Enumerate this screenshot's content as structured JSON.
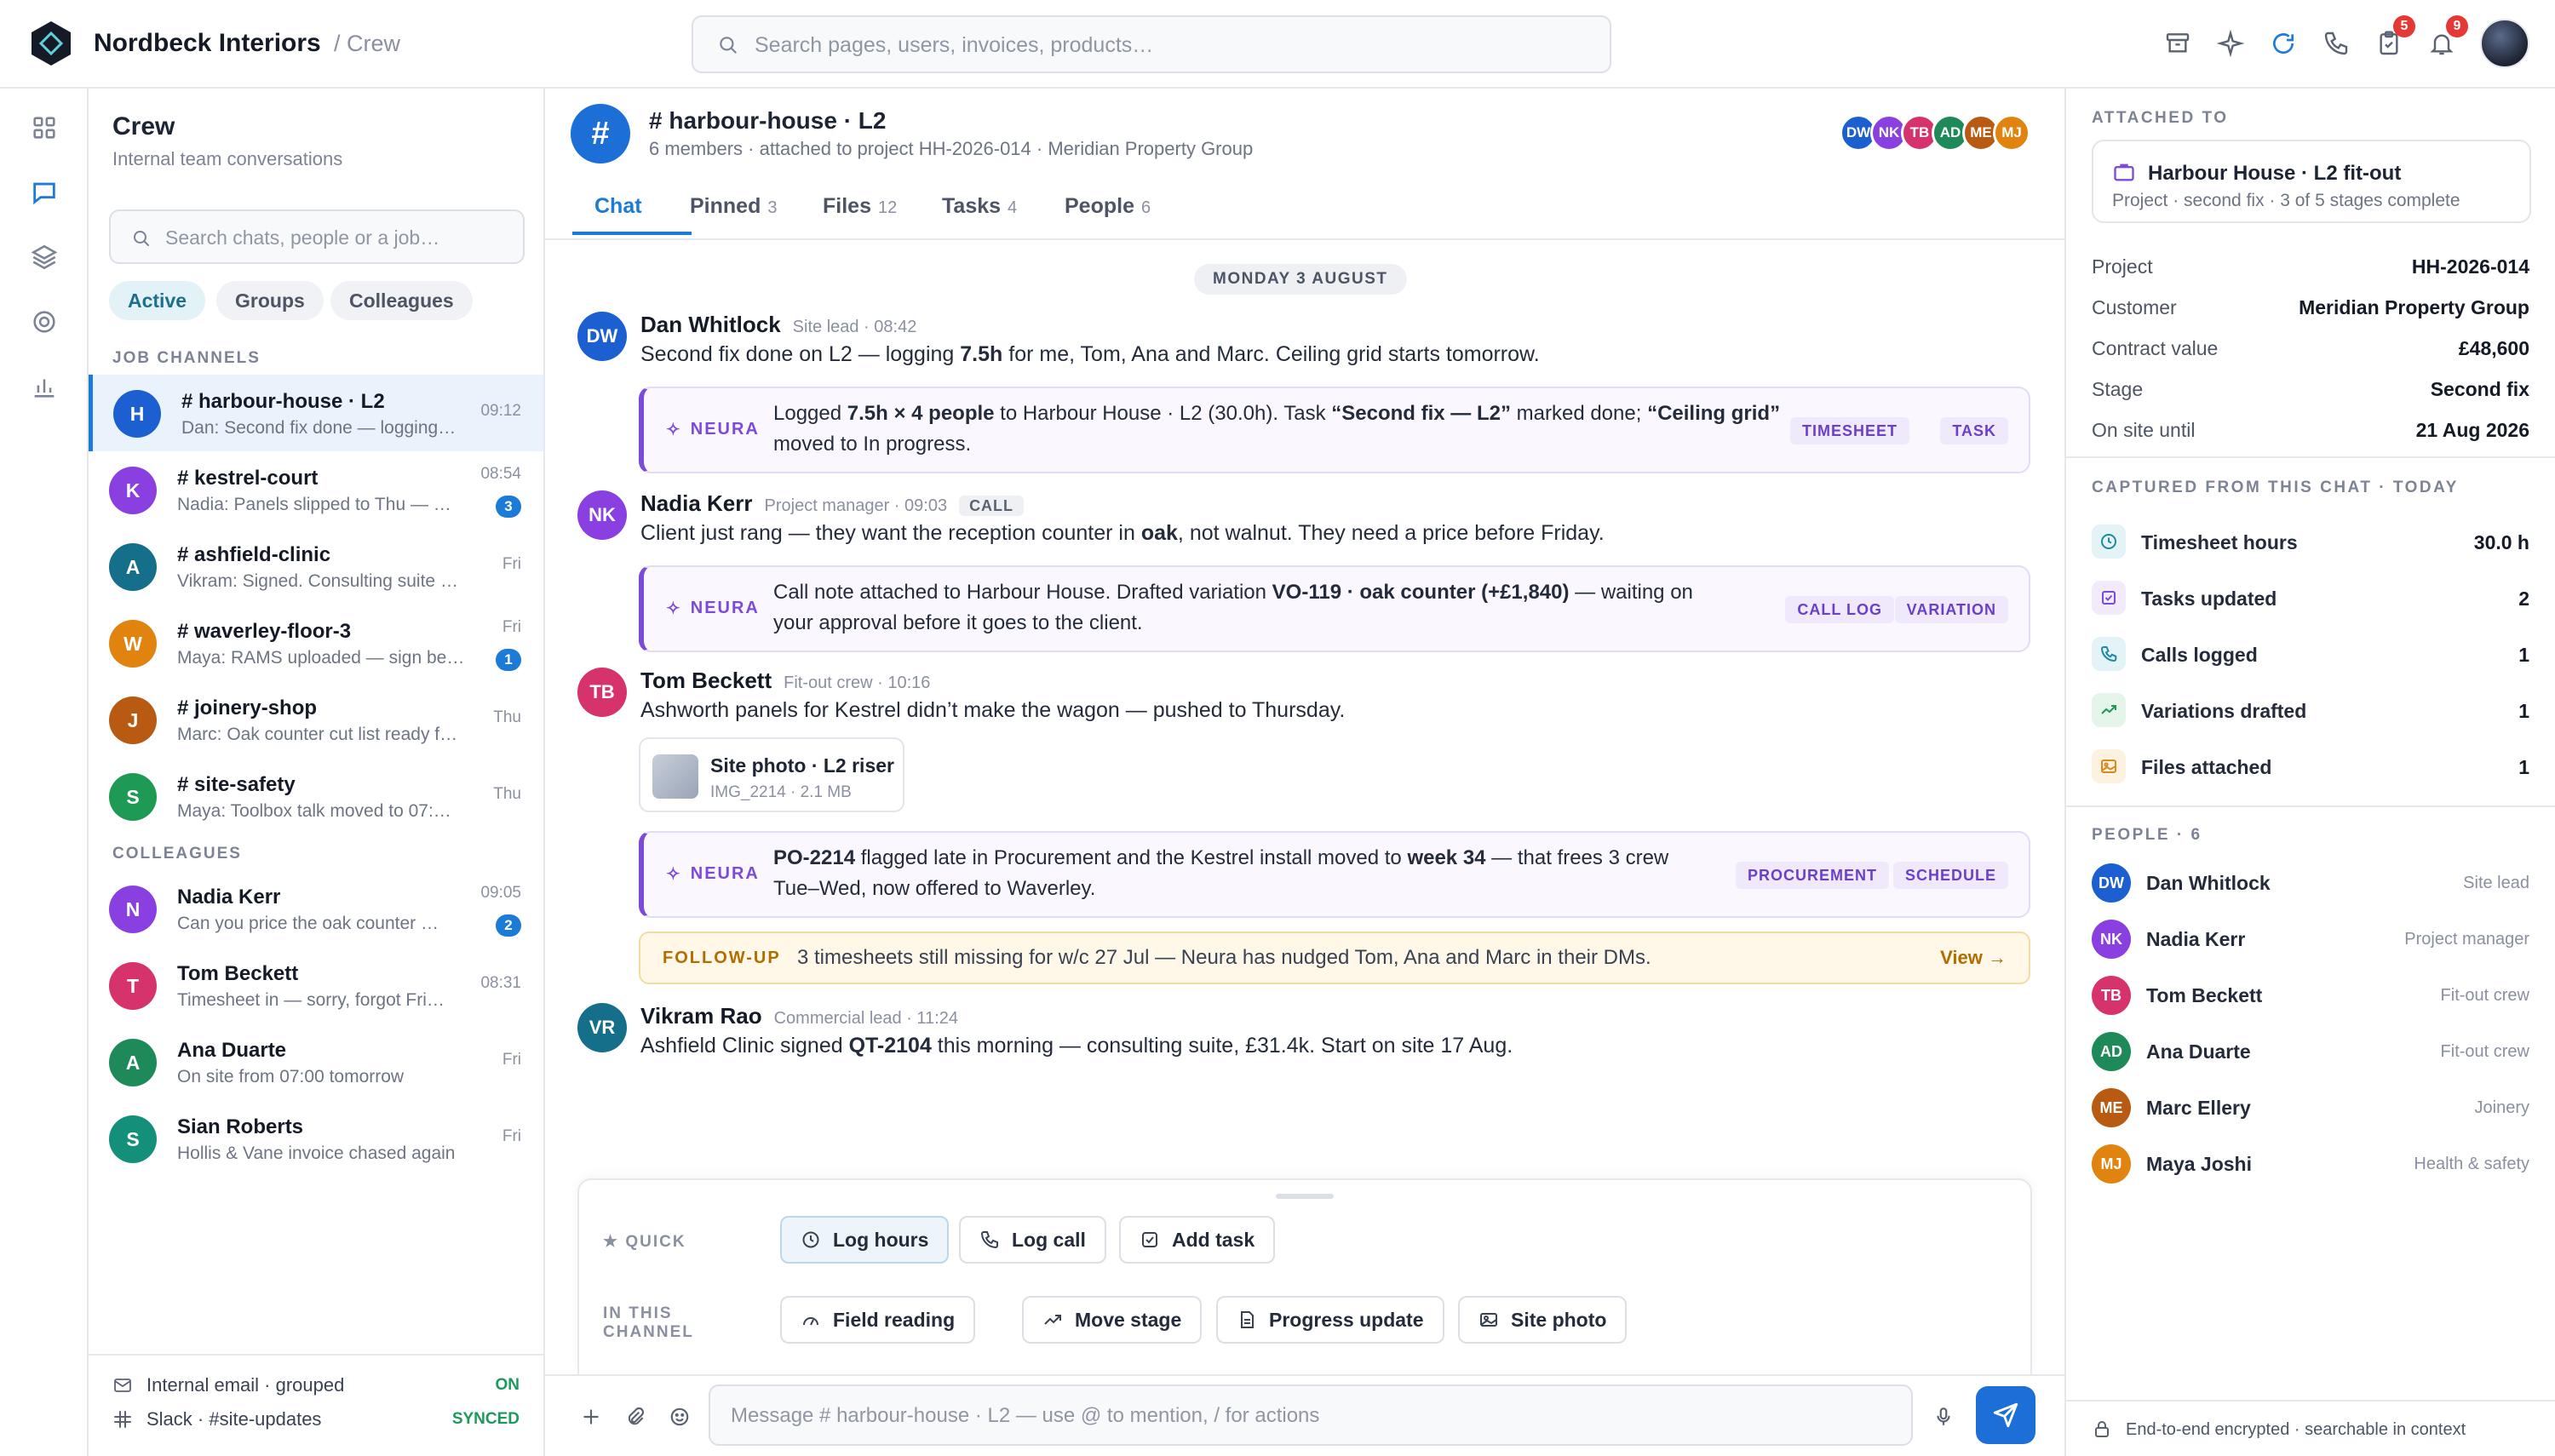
{
  "app": {
    "name": "Nordbeck Interiors",
    "crumb": "/ Crew"
  },
  "search": {
    "placeholder": "Search pages, users, invoices, products…"
  },
  "topbar": {
    "tasks_badge": "5",
    "notif_badge": "9"
  },
  "sidebar": {
    "title": "Crew",
    "subtitle": "Internal team conversations",
    "search_placeholder": "Search chats, people or a job…",
    "chips": [
      "Active",
      "Groups",
      "Colleagues"
    ],
    "job_label": "JOB CHANNELS",
    "colleagues_label": "COLLEAGUES",
    "channels": [
      {
        "initial": "H",
        "color": "#1b5fd0",
        "name": "# harbour-house · L2",
        "preview": "Dan: Second fix done — logging…",
        "time": "09:12",
        "badge": ""
      },
      {
        "initial": "K",
        "color": "#8a3fe0",
        "name": "# kestrel-court",
        "preview": "Nadia: Panels slipped to Thu — …",
        "time": "08:54",
        "badge": "3"
      },
      {
        "initial": "A",
        "color": "#166f8a",
        "name": "# ashfield-clinic",
        "preview": "Vikram: Signed. Consulting suite s…",
        "time": "Fri",
        "badge": ""
      },
      {
        "initial": "W",
        "color": "#e0840f",
        "name": "# waverley-floor-3",
        "preview": "Maya: RAMS uploaded — sign bef…",
        "time": "Fri",
        "badge": "1"
      },
      {
        "initial": "J",
        "color": "#b85a12",
        "name": "# joinery-shop",
        "preview": "Marc: Oak counter cut list ready f…",
        "time": "Thu",
        "badge": ""
      },
      {
        "initial": "S",
        "color": "#1f9a55",
        "name": "# site-safety",
        "preview": "Maya: Toolbox talk moved to 07:…",
        "time": "Thu",
        "badge": ""
      }
    ],
    "colleagues": [
      {
        "initial": "N",
        "color": "#8a3fe0",
        "name": "Nadia Kerr",
        "preview": "Can you price the oak counter …",
        "time": "09:05",
        "badge": "2",
        "online": true
      },
      {
        "initial": "T",
        "color": "#d6336c",
        "name": "Tom Beckett",
        "preview": "Timesheet in — sorry, forgot Fri…",
        "time": "08:31",
        "badge": "",
        "online": true
      },
      {
        "initial": "A",
        "color": "#1e8a5a",
        "name": "Ana Duarte",
        "preview": "On site from 07:00 tomorrow",
        "time": "Fri",
        "badge": "",
        "online": false
      },
      {
        "initial": "S",
        "color": "#14907a",
        "name": "Sian Roberts",
        "preview": "Hollis & Vane invoice chased again",
        "time": "Fri",
        "badge": "",
        "online": false
      }
    ],
    "footer": [
      {
        "label": "Internal email · grouped",
        "status": "ON"
      },
      {
        "label": "Slack · #site-updates",
        "status": "SYNCED"
      }
    ]
  },
  "channel": {
    "title": "# harbour-house · L2",
    "meta": "6 members · attached to project HH-2026-014 · Meridian Property Group",
    "members": [
      {
        "initials": "DW",
        "color": "#1b5fd0"
      },
      {
        "initials": "NK",
        "color": "#8a3fe0"
      },
      {
        "initials": "TB",
        "color": "#d6336c"
      },
      {
        "initials": "AD",
        "color": "#1e8a5a"
      },
      {
        "initials": "ME",
        "color": "#b85a12"
      },
      {
        "initials": "MJ",
        "color": "#e0840f"
      }
    ],
    "tabs": [
      {
        "label": "Chat",
        "count": ""
      },
      {
        "label": "Pinned",
        "count": "3"
      },
      {
        "label": "Files",
        "count": "12"
      },
      {
        "label": "Tasks",
        "count": "4"
      },
      {
        "label": "People",
        "count": "6"
      }
    ],
    "day": "MONDAY 3 AUGUST",
    "neura_label": "NEURA",
    "messages": {
      "m1": {
        "initials": "DW",
        "color": "#1b5fd0",
        "name": "Dan Whitlock",
        "role": "Site lead · 08:42",
        "t1": "Second fix done on L2 — logging ",
        "b1": "7.5h",
        "t2": " for me, Tom, Ana and Marc. Ceiling grid starts tomorrow."
      },
      "n1": {
        "t1": "Logged ",
        "b1": "7.5h × 4 people",
        "t2": " to Harbour House · L2 (30.0h). Task ",
        "b2": "“Second fix — L2”",
        "t3": " marked done; ",
        "b3": "“Ceiling grid”",
        "line2": "moved to In progress.",
        "tags": [
          "TIMESHEET",
          "TASK"
        ]
      },
      "m2": {
        "initials": "NK",
        "color": "#8a3fe0",
        "name": "Nadia Kerr",
        "role": "Project manager · 09:03",
        "tag": "CALL",
        "t1": "Client just rang — they want the reception counter in ",
        "b1": "oak",
        "t2": ", not walnut. They need a price before Friday."
      },
      "n2": {
        "t1": "Call note attached to Harbour House. Drafted variation ",
        "b1": "VO-119 · oak counter (+£1,840)",
        "t2": " — waiting on",
        "line2": "your approval before it goes to the client.",
        "tags": [
          "CALL LOG",
          "VARIATION"
        ]
      },
      "m3": {
        "initials": "TB",
        "color": "#d6336c",
        "name": "Tom Beckett",
        "role": "Fit-out crew · 10:16",
        "text": "Ashworth panels for Kestrel didn’t make the wagon — pushed to Thursday."
      },
      "file": {
        "name": "Site photo · L2 riser",
        "meta": "IMG_2214 · 2.1 MB"
      },
      "n3": {
        "b1": "PO-2214",
        "t1": " flagged late in Procurement and the Kestrel install moved to ",
        "b2": "week 34",
        "t2": " — that frees 3 crew",
        "line2": "Tue–Wed, now offered to Waverley.",
        "tags": [
          "PROCUREMENT",
          "SCHEDULE"
        ]
      },
      "follow": {
        "label": "FOLLOW-UP",
        "text": "3 timesheets still missing for w/c 27 Jul — Neura has nudged Tom, Ana and Marc in their DMs.",
        "action": "View →"
      },
      "m4": {
        "initials": "VR",
        "color": "#166f8a",
        "name": "Vikram Rao",
        "role": "Commercial lead · 11:24",
        "t1": "Ashfield Clinic signed ",
        "b1": "QT-2104",
        "t2": " this morning — consulting suite, £31.4k. Start on site 17 Aug."
      }
    }
  },
  "composer": {
    "quick_label": "QUICK",
    "channel_label_1": "IN THIS",
    "channel_label_2": "CHANNEL",
    "quick": [
      "Log hours",
      "Log call",
      "Add task"
    ],
    "channel_actions": [
      "Field reading",
      "Move stage",
      "Progress update",
      "Site photo"
    ],
    "placeholder": "Message # harbour-house · L2 — use @ to mention, / for actions"
  },
  "right": {
    "attached_label": "ATTACHED TO",
    "card_title": "Harbour House · L2 fit-out",
    "card_sub": "Project · second fix · 3 of 5 stages complete",
    "fields": [
      {
        "k": "Project",
        "v": "HH-2026-014"
      },
      {
        "k": "Customer",
        "v": "Meridian Property Group"
      },
      {
        "k": "Contract value",
        "v": "£48,600"
      },
      {
        "k": "Stage",
        "v": "Second fix"
      },
      {
        "k": "On site until",
        "v": "21 Aug 2026"
      }
    ],
    "captured_label": "CAPTURED FROM THIS CHAT · TODAY",
    "captured": [
      {
        "icon": "clock-icon",
        "label": "Timesheet hours",
        "value": "30.0 h",
        "bg": "#e3f3f6",
        "fg": "#1d8aa0"
      },
      {
        "icon": "checkbox-icon",
        "label": "Tasks updated",
        "value": "2",
        "bg": "#f1ebfb",
        "fg": "#7c4ad9"
      },
      {
        "icon": "phone-icon",
        "label": "Calls logged",
        "value": "1",
        "bg": "#e3f3f6",
        "fg": "#1d8aa0"
      },
      {
        "icon": "trend-icon",
        "label": "Variations drafted",
        "value": "1",
        "bg": "#e6f5ea",
        "fg": "#1f9a55"
      },
      {
        "icon": "image-icon",
        "label": "Files attached",
        "value": "1",
        "bg": "#fdf1e0",
        "fg": "#d98a1c"
      }
    ],
    "people_label": "PEOPLE · 6",
    "people": [
      {
        "initials": "DW",
        "color": "#1b5fd0",
        "name": "Dan Whitlock",
        "role": "Site lead"
      },
      {
        "initials": "NK",
        "color": "#8a3fe0",
        "name": "Nadia Kerr",
        "role": "Project manager"
      },
      {
        "initials": "TB",
        "color": "#d6336c",
        "name": "Tom Beckett",
        "role": "Fit-out crew"
      },
      {
        "initials": "AD",
        "color": "#1e8a5a",
        "name": "Ana Duarte",
        "role": "Fit-out crew"
      },
      {
        "initials": "ME",
        "color": "#b85a12",
        "name": "Marc Ellery",
        "role": "Joinery"
      },
      {
        "initials": "MJ",
        "color": "#e0840f",
        "name": "Maya Joshi",
        "role": "Health & safety"
      }
    ],
    "footer": "End-to-end encrypted · searchable in context"
  }
}
